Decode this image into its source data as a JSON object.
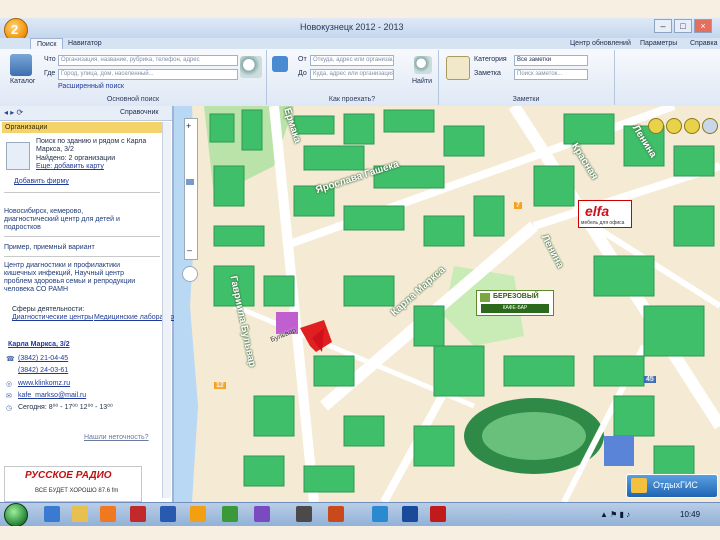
{
  "window": {
    "title": "Новокузнецк 2012 - 2013",
    "controls": [
      "–",
      "□",
      "×"
    ]
  },
  "ribbon_tabs": [
    {
      "label": "Поиск",
      "active": true
    },
    {
      "label": "Навигатор",
      "active": false
    }
  ],
  "ribbon_right": [
    {
      "label": "Центр обновлений"
    },
    {
      "label": "Параметры"
    },
    {
      "label": "Справка"
    }
  ],
  "search_group": {
    "catalog_label": "Каталог",
    "what_label": "Что",
    "what_placeholder": "Организация, название, рубрика, телефон, адрес",
    "where_label": "Где",
    "where_placeholder": "Город, улица, дом, населенный...",
    "extended_label": "Расширенный поиск",
    "group_label": "Основной поиск"
  },
  "route_group": {
    "from_label": "От",
    "from_placeholder": "Откуда, адрес или организация",
    "to_label": "До",
    "to_placeholder": "Куда, адрес или организация",
    "find_label": "Найти",
    "group_label": "Как проехать?"
  },
  "notes_group": {
    "category_label": "Категория",
    "category_value": "Все заметки",
    "search_label": "Заметка",
    "search_placeholder": "Поиск заметок...",
    "group_label": "Заметки"
  },
  "left_panel": {
    "toolbar_right": "Справочник",
    "header": "Организации",
    "result_lines": [
      "Поиск по зданию и рядом с Карла",
      "Маркса, 3/2",
      "Найдено: 2 организации",
      "Еще: добавить карту"
    ],
    "add_firm": "Добавить фирму",
    "org1": [
      "Новосибирск, кемерово,",
      "диагностический центр для детей и",
      "подростков"
    ],
    "org2": "Пример, приемный вариант",
    "org3": [
      "Центр диагностики и профилактики",
      "кишечных инфекций, Научный центр",
      "проблем здоровья семьи и репродукции",
      "человека СО РАМН"
    ],
    "activities_label": "Сферы деятельности:",
    "activities": [
      "Диагностические центры",
      "Медицинские лаборатории"
    ],
    "address": "Карла Маркса, 3/2",
    "phones": [
      "(3842) 21-04-45",
      "(3842) 24-03-61"
    ],
    "site": "www.klinkomz.ru",
    "email": "kafe_markso@mail.ru",
    "hours": "Сегодня: 8⁰⁰ - 17⁰⁰  12⁰⁰ - 13⁰⁰",
    "footer_link": "Нашли неточность?"
  },
  "ad_banner": {
    "title": "РУССКОЕ РАДИО",
    "tagline": "ВСЕ БУДЕТ ХОРОШО 87.6 fm"
  },
  "map": {
    "streets": [
      {
        "label": "Ермака"
      },
      {
        "label": "Ярослава Гашека"
      },
      {
        "label": "Красная"
      },
      {
        "label": "Ленина"
      },
      {
        "label": "Ленина"
      },
      {
        "label": "Карла Маркса"
      },
      {
        "label": "Гавриила Бульвар"
      },
      {
        "label": "Бульвар"
      }
    ],
    "elfa_logo": "elfa",
    "elfa_sub": "мебель для офиса",
    "berez_title": "БЕРЕЗОВЫЙ",
    "berez_sub": "КАФЕ-БАР",
    "otdyh_label": "ОтдыхГИС",
    "numbers": [
      "12",
      "7",
      "45"
    ]
  },
  "taskbar": {
    "clock": "10:49"
  },
  "colors": {
    "map_bg": "#f5ead4",
    "building": "#3fbf6a",
    "building_dark": "#2f9a52",
    "road": "#ffffff",
    "river": "#b8d8f4",
    "accent_red": "#d0101a"
  }
}
